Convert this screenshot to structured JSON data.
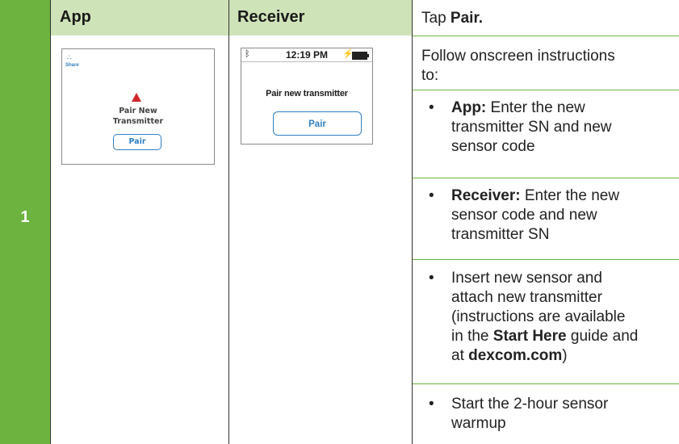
{
  "step": {
    "number": "1"
  },
  "headers": {
    "app": "App",
    "receiver": "Receiver"
  },
  "app_screen": {
    "share_label": "Share",
    "title_line1": "Pair New",
    "title_line2": "Transmitter",
    "button": "Pair"
  },
  "receiver_screen": {
    "time": "12:19 PM",
    "title": "Pair new transmitter",
    "button": "Pair"
  },
  "instructions": {
    "tap_prefix": "Tap ",
    "tap_bold": "Pair.",
    "follow_line1": "Follow onscreen instructions",
    "follow_line2": "to:",
    "bullet1_bold": "App:",
    "bullet1_line1": " Enter the new",
    "bullet1_line2": "transmitter SN and new",
    "bullet1_line3": "sensor code",
    "bullet2_bold": "Receiver:",
    "bullet2_line1": " Enter the new",
    "bullet2_line2": "sensor code and new",
    "bullet2_line3": "transmitter SN",
    "bullet3_line1": "Insert new sensor and",
    "bullet3_line2": "attach new transmitter",
    "bullet3_line3": "(instructions are available",
    "bullet3_line4_prefix": "in the ",
    "bullet3_line4_bold": "Start Here",
    "bullet3_line4_suffix": " guide and",
    "bullet3_line5_prefix": "at ",
    "bullet3_line5_bold": "dexcom.com",
    "bullet3_line5_suffix": ")",
    "bullet4_line1": "Start the 2-hour sensor",
    "bullet4_line2": "warmup",
    "bullet_char": "•"
  },
  "colors": {
    "green": "#6cb33f",
    "light_green": "#cfe3b8",
    "blue": "#2f7fc1",
    "red": "#d0262d"
  }
}
